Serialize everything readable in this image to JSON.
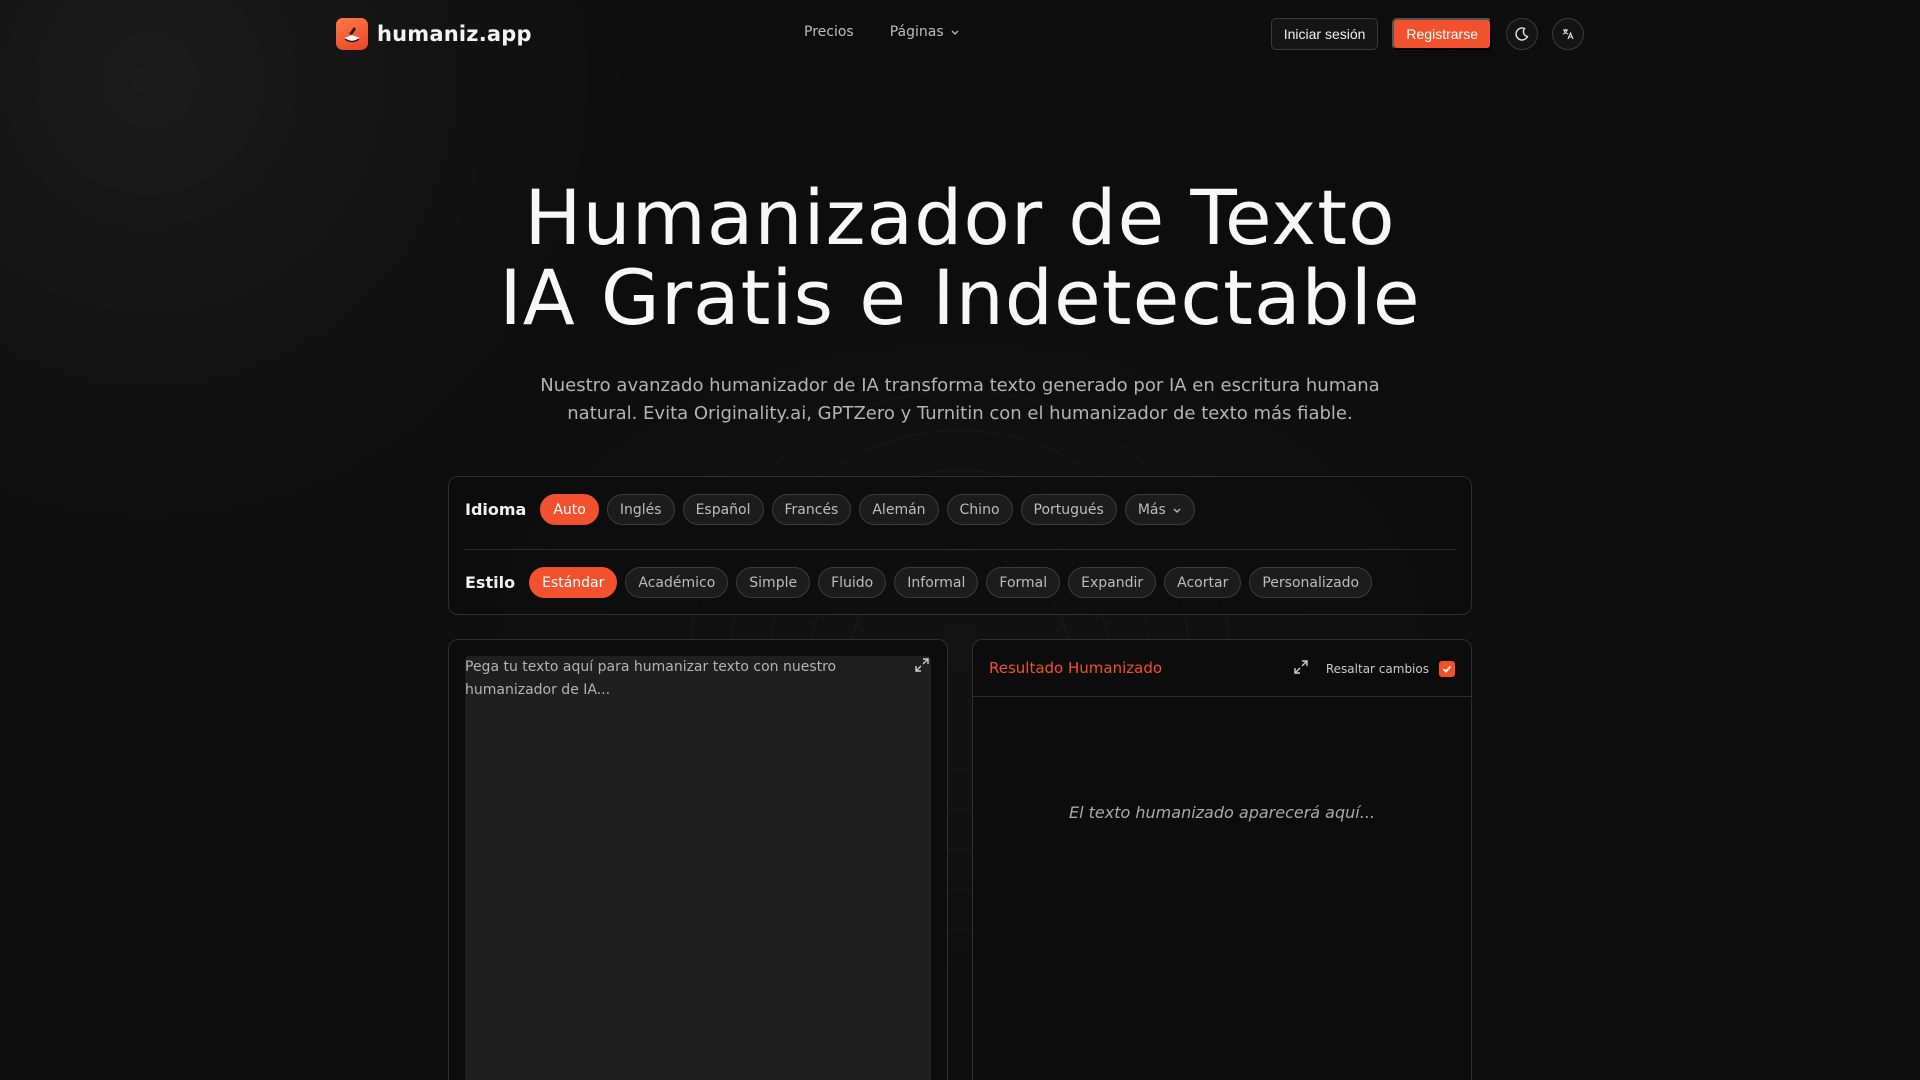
{
  "brand": {
    "name": "humaniz.app"
  },
  "nav": {
    "links": [
      {
        "label": "Precios"
      },
      {
        "label": "Páginas"
      }
    ],
    "login_label": "Iniciar sesión",
    "signup_label": "Registrarse"
  },
  "hero": {
    "title_line1": "Humanizador de Texto",
    "title_line2": "IA Gratis e Indetectable",
    "subtitle_line1": "Nuestro avanzado humanizador de IA transforma texto generado por IA en escritura humana",
    "subtitle_line2": "natural. Evita Originality.ai, GPTZero y Turnitin con el humanizador de texto más fiable."
  },
  "options": {
    "language": {
      "label": "Idioma",
      "items": [
        "Auto",
        "Inglés",
        "Español",
        "Francés",
        "Alemán",
        "Chino",
        "Portugués",
        "Más"
      ],
      "selected": "Auto"
    },
    "style": {
      "label": "Estilo",
      "items": [
        "Estándar",
        "Académico",
        "Simple",
        "Fluido",
        "Informal",
        "Formal",
        "Expandir",
        "Acortar",
        "Personalizado"
      ],
      "selected": "Estándar"
    }
  },
  "input": {
    "placeholder": "Pega tu texto aquí para humanizar texto con nuestro humanizador de IA..."
  },
  "output": {
    "title": "Resultado Humanizado",
    "highlight_label": "Resaltar cambios",
    "highlight_checked": true,
    "placeholder": "El texto humanizado aparecerá aquí..."
  },
  "colors": {
    "accent": "#f2512d",
    "background": "#0d0d0d",
    "panel": "#0c0c0c",
    "input_bg": "#1f1f1f"
  }
}
